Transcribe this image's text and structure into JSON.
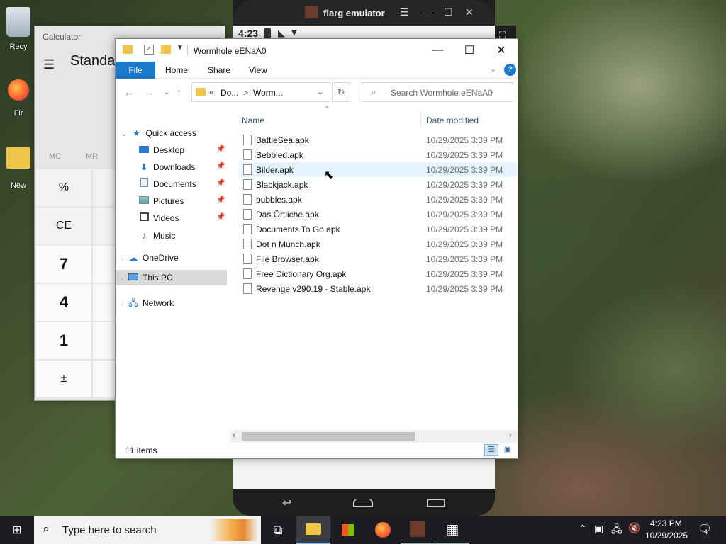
{
  "desktop": {
    "icons": [
      {
        "label": "Recy",
        "icon": "recycle-bin-icon"
      },
      {
        "label": "Fir",
        "icon": "firefox-icon"
      },
      {
        "label": "New",
        "icon": "folder-icon"
      }
    ]
  },
  "calculator": {
    "title": "Calculator",
    "mode": "Standar",
    "memory": [
      "MC",
      "MR"
    ],
    "keys": [
      "%",
      "CE",
      "7",
      "4",
      "1",
      "±"
    ]
  },
  "emulator": {
    "title": "flarg emulator",
    "time": "4:23"
  },
  "explorer": {
    "title": "Wormhole eENaA0",
    "ribbon_tabs": [
      "File",
      "Home",
      "Share",
      "View"
    ],
    "address": {
      "prefix": "«",
      "parent": "Do...",
      "sep": ">",
      "current": "Worm..."
    },
    "search_placeholder": "Search Wormhole eENaA0",
    "nav": {
      "quick_access": "Quick access",
      "items": [
        "Desktop",
        "Downloads",
        "Documents",
        "Pictures",
        "Videos",
        "Music"
      ],
      "onedrive": "OneDrive",
      "this_pc": "This PC",
      "network": "Network"
    },
    "columns": {
      "name": "Name",
      "date": "Date modified"
    },
    "files": [
      {
        "name": "BattleSea.apk",
        "date": "10/29/2025 3:39 PM"
      },
      {
        "name": "Bebbled.apk",
        "date": "10/29/2025 3:39 PM"
      },
      {
        "name": "Bilder.apk",
        "date": "10/29/2025 3:39 PM"
      },
      {
        "name": "Blackjack.apk",
        "date": "10/29/2025 3:39 PM"
      },
      {
        "name": "bubbles.apk",
        "date": "10/29/2025 3:39 PM"
      },
      {
        "name": "Das Örtliche.apk",
        "date": "10/29/2025 3:39 PM"
      },
      {
        "name": "Documents To Go.apk",
        "date": "10/29/2025 3:39 PM"
      },
      {
        "name": "Dot n Munch.apk",
        "date": "10/29/2025 3:39 PM"
      },
      {
        "name": "File Browser.apk",
        "date": "10/29/2025 3:39 PM"
      },
      {
        "name": "Free Dictionary Org.apk",
        "date": "10/29/2025 3:39 PM"
      },
      {
        "name": "Revenge v290.19 - Stable.apk",
        "date": "10/29/2025 3:39 PM"
      }
    ],
    "status": "11 items"
  },
  "taskbar": {
    "search_placeholder": "Type here to search",
    "time": "4:23 PM",
    "date": "10/29/2025",
    "notifications": "4"
  }
}
